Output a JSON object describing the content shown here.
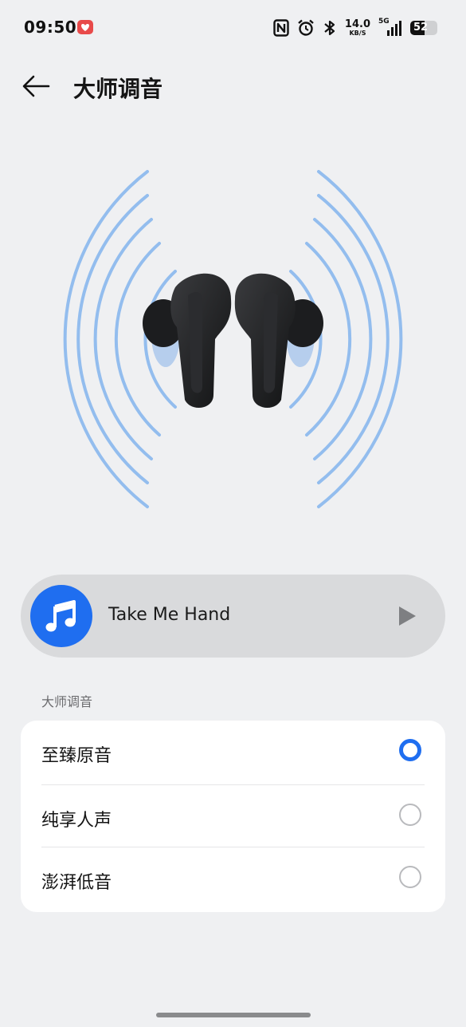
{
  "status_bar": {
    "time": "09:50",
    "net_speed_value": "14.0",
    "net_speed_unit": "KB/S",
    "network_type": "5G",
    "battery_level": "52",
    "battery_fraction": 0.52
  },
  "header": {
    "title": "大师调音"
  },
  "player": {
    "song_title": "Take Me Hand"
  },
  "section": {
    "label": "大师调音",
    "options": [
      {
        "label": "至臻原音",
        "selected": true
      },
      {
        "label": "纯享人声",
        "selected": false
      },
      {
        "label": "澎湃低音",
        "selected": false
      }
    ]
  },
  "colors": {
    "accent": "#1f6ef0",
    "background": "#eff0f2",
    "card": "#ffffff",
    "player_bg": "#d9dadc",
    "wave": "#7fb2ec"
  },
  "icons": {
    "back": "arrow-left-icon",
    "music": "music-note-icon",
    "play": "play-icon",
    "nfc": "nfc-icon",
    "alarm": "alarm-icon",
    "bluetooth": "bluetooth-icon",
    "signal": "signal-icon",
    "battery": "battery-icon"
  }
}
